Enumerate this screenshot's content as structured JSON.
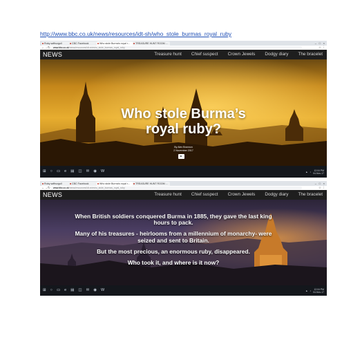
{
  "caption": {
    "url": "http://www.bbc.co.uk/news/resources/idt-sh/who_stole_burmas_royal_ruby"
  },
  "browser": {
    "tabs": [
      "Ruby saffrozgull",
      "CBC Facebook",
      "Who stole Burma's royal r...",
      "TREASURE HUNT ROOM ..."
    ],
    "address_host": "www.bbc.co.uk",
    "address_path": "/news/resources/idt-sh/who_stole_burmas_royal_ruby"
  },
  "site": {
    "logo": "NEWS",
    "nav": [
      "Treasure hunt",
      "Chief suspect",
      "Crown Jewels",
      "Dodgy diary",
      "The bracelet"
    ]
  },
  "screen1": {
    "title_line1": "Who stole Burma’s",
    "title_line2": "royal ruby?",
    "byline_author": "By Alex Brannon",
    "byline_date": "2 November 2017"
  },
  "screen2": {
    "paragraphs": [
      "When British soldiers conquered Burma in 1885, they gave the last king hours to pack.",
      "Many of his treasures - heirlooms from a millennium of monarchy- were seized and sent to Britain.",
      "But the most precious, an enormous ruby, disappeared.",
      "Who took it, and where is it now?"
    ]
  },
  "taskbar": {
    "time": "12:04 PM",
    "date": "04-Nov-17"
  },
  "colors": {
    "link": "#1f4fb5",
    "site_header": "#1e1e1e",
    "sunset_gold": "#d79a1a",
    "dusk_purple": "#4a3d62"
  }
}
